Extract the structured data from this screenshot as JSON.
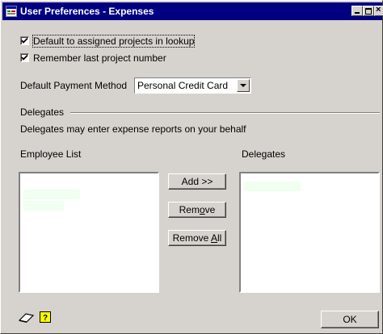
{
  "window": {
    "title": "User Preferences - Expenses"
  },
  "options": {
    "default_assigned_label": "Default to assigned projects in lookup",
    "default_assigned_checked": true,
    "remember_last_label": "Remember last project number",
    "remember_last_checked": true
  },
  "payment": {
    "label": "Default Payment Method",
    "value": "Personal Credit Card"
  },
  "delegates_section": {
    "heading": "Delegates",
    "description": "Delegates may enter expense reports on your behalf",
    "employee_list_label": "Employee List",
    "delegates_label": "Delegates",
    "add_button": "Add >>",
    "remove_button_pre": "Rem",
    "remove_button_mnemonic": "o",
    "remove_button_post": "ve",
    "remove_all_pre": "Remove ",
    "remove_all_mnemonic": "A",
    "remove_all_post": "ll"
  },
  "footer": {
    "ok_button": "OK",
    "icons": [
      "eraser-icon",
      "help-icon"
    ]
  },
  "colors": {
    "titlebar": "#000080",
    "face": "#d6d3ce"
  }
}
